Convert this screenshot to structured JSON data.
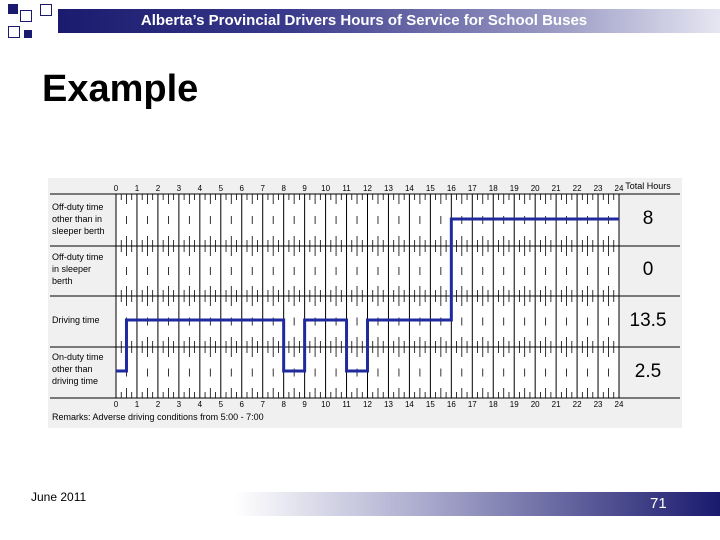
{
  "slide": {
    "title": "Alberta’s Provincial Drivers Hours of Service for School Buses",
    "heading": "Example",
    "footer_date": "June 2011",
    "page_number": "71"
  },
  "logbook": {
    "total_hours_label": "Total Hours",
    "hour_labels": [
      "0",
      "1",
      "2",
      "3",
      "4",
      "5",
      "6",
      "7",
      "8",
      "9",
      "10",
      "11",
      "12",
      "13",
      "14",
      "15",
      "16",
      "17",
      "18",
      "19",
      "20",
      "21",
      "22",
      "23",
      "24"
    ],
    "rows": [
      {
        "label_lines": [
          "Off-duty time",
          "other than in",
          "sleeper berth"
        ],
        "total": "8"
      },
      {
        "label_lines": [
          "Off-duty time",
          "in sleeper",
          "berth"
        ],
        "total": "0"
      },
      {
        "label_lines": [
          "Driving time"
        ],
        "total": "13.5"
      },
      {
        "label_lines": [
          "On-duty time",
          "other than",
          "driving time"
        ],
        "total": "2.5"
      }
    ],
    "remarks": "Remarks: Adverse driving conditions from 5:00 - 7:00",
    "duty_status_segments": [
      {
        "status": 3,
        "start": 0,
        "end": 0.5
      },
      {
        "status": 2,
        "start": 0.5,
        "end": 8
      },
      {
        "status": 3,
        "start": 8,
        "end": 9
      },
      {
        "status": 2,
        "start": 9,
        "end": 11
      },
      {
        "status": 3,
        "start": 11,
        "end": 12
      },
      {
        "status": 2,
        "start": 12,
        "end": 16
      },
      {
        "status": 0,
        "start": 16,
        "end": 24
      }
    ],
    "line_color": "#1f2a9c"
  }
}
